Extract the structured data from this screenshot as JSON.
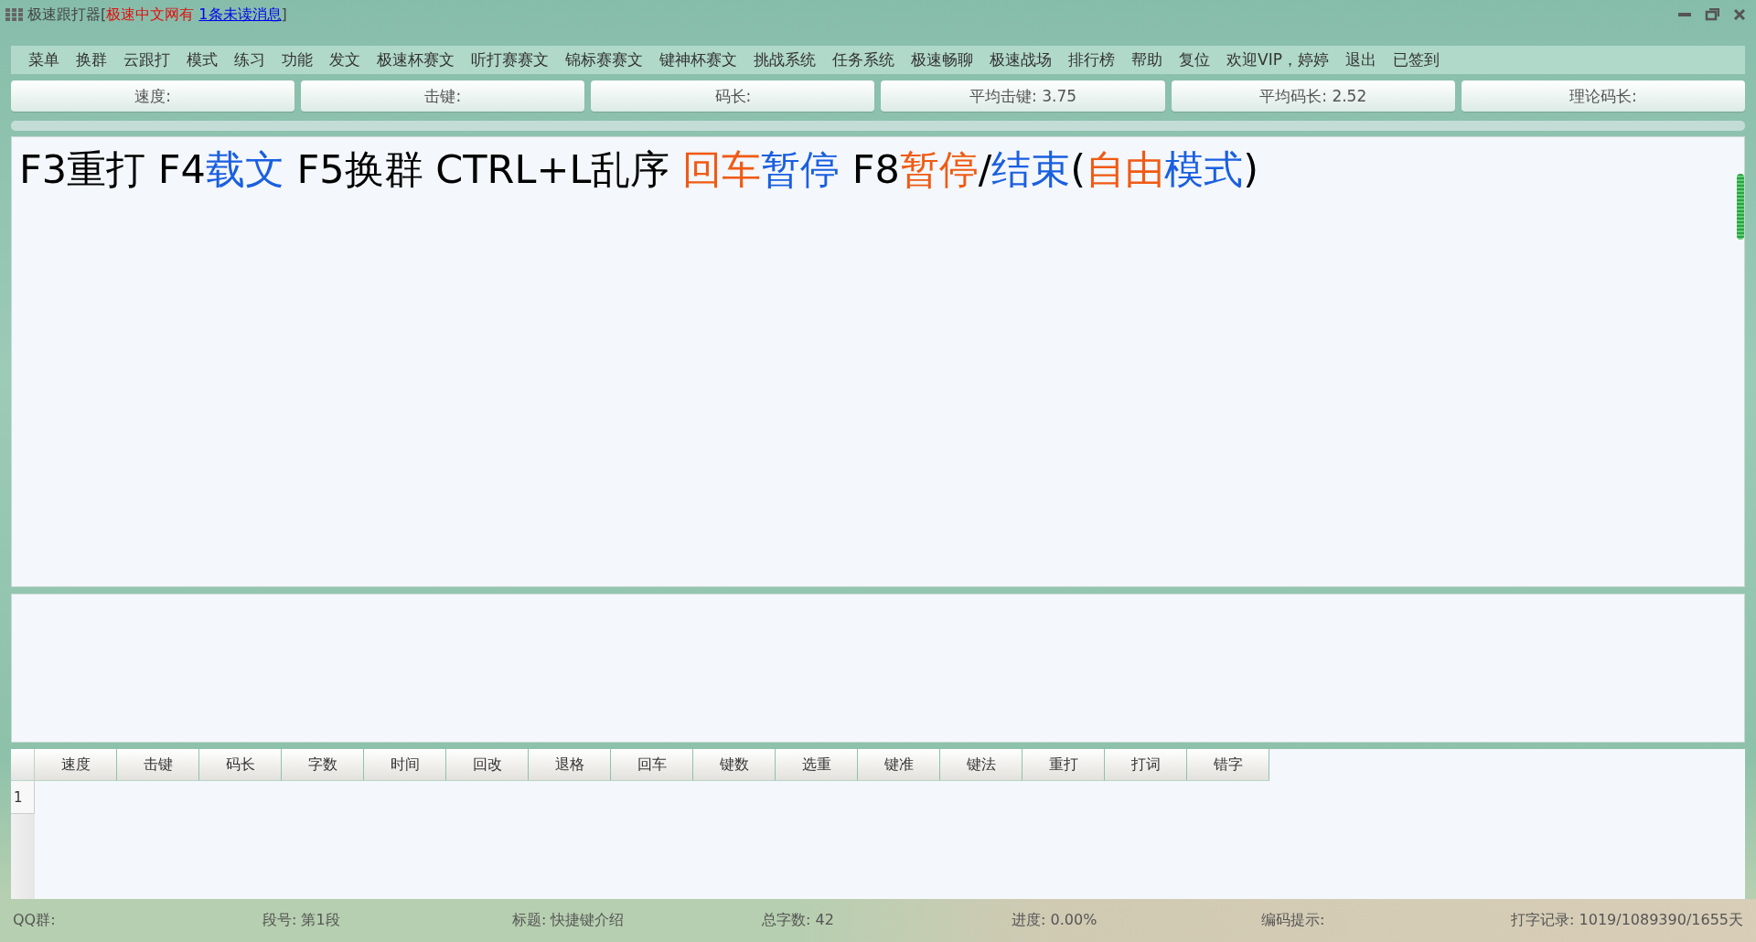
{
  "window": {
    "title": "极速跟打器",
    "title_open": "[",
    "title_close": "]",
    "title_notice": "极速中文网有",
    "unread_link": "1条未读消息"
  },
  "menu": [
    "菜单",
    "换群",
    "云跟打",
    "模式",
    "练习",
    "功能",
    "发文",
    "极速杯赛文",
    "听打赛赛文",
    "锦标赛赛文",
    "键神杯赛文",
    "挑战系统",
    "任务系统",
    "极速畅聊",
    "极速战场",
    "排行榜",
    "帮助",
    "复位",
    "欢迎VIP，婷婷",
    "退出",
    "已签到"
  ],
  "stats": [
    "速度:",
    "击键:",
    "码长:",
    "平均击键: 3.75",
    "平均码长: 2.52",
    "理论码长:"
  ],
  "progress": {
    "level": 0
  },
  "text_segments": [
    {
      "text": "F3重打 F4",
      "color": "#000000"
    },
    {
      "text": "载文",
      "color": "#1a5fe0"
    },
    {
      "text": " F5换群 CTRL+L乱序 ",
      "color": "#000000"
    },
    {
      "text": "回车",
      "color": "#f05a14"
    },
    {
      "text": "暂停",
      "color": "#1a5fe0"
    },
    {
      "text": " F8",
      "color": "#000000"
    },
    {
      "text": "暂停",
      "color": "#f05a14"
    },
    {
      "text": "/",
      "color": "#000000"
    },
    {
      "text": "结束",
      "color": "#1a5fe0"
    },
    {
      "text": "(",
      "color": "#000000"
    },
    {
      "text": "自由",
      "color": "#f05a14"
    },
    {
      "text": "模式",
      "color": "#1a5fe0"
    },
    {
      "text": ")",
      "color": "#000000"
    }
  ],
  "table": {
    "columns": [
      "速度",
      "击键",
      "码长",
      "字数",
      "时间",
      "回改",
      "退格",
      "回车",
      "键数",
      "选重",
      "键准",
      "键法",
      "重打",
      "打词",
      "错字"
    ],
    "row_numbers": [
      "1"
    ]
  },
  "status_bar": [
    "QQ群:",
    "段号: 第1段",
    "标题: 快捷键介绍",
    "总字数: 42",
    "进度: 0.00%",
    "编码提示:",
    "打字记录: 1019/1089390/1655天"
  ]
}
